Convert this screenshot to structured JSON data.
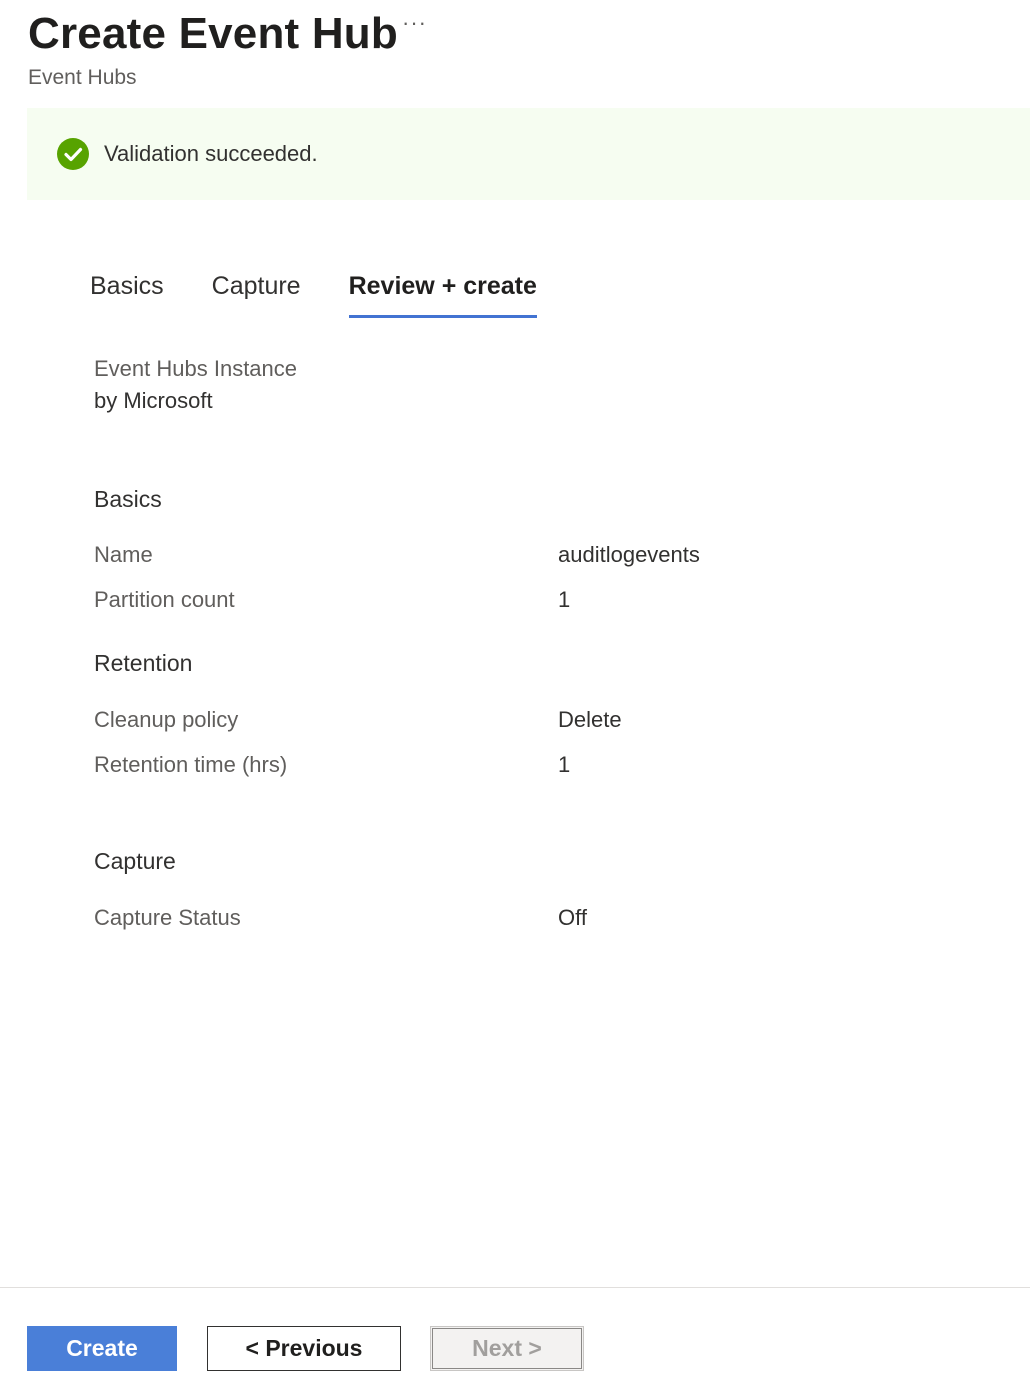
{
  "header": {
    "title": "Create Event Hub",
    "more_label": "···",
    "subtitle": "Event Hubs"
  },
  "banner": {
    "text": "Validation succeeded.",
    "icon": "success-check-icon",
    "color": "#57a300"
  },
  "tabs": [
    {
      "label": "Basics",
      "active": false
    },
    {
      "label": "Capture",
      "active": false
    },
    {
      "label": "Review + create",
      "active": true
    }
  ],
  "product": {
    "name": "Event Hubs Instance",
    "publisher": "by Microsoft"
  },
  "sections": {
    "basics": {
      "title": "Basics",
      "rows": [
        {
          "label": "Name",
          "value": "auditlogevents"
        },
        {
          "label": "Partition count",
          "value": "1"
        }
      ]
    },
    "retention": {
      "title": "Retention",
      "rows": [
        {
          "label": "Cleanup policy",
          "value": "Delete"
        },
        {
          "label": "Retention time (hrs)",
          "value": "1"
        }
      ]
    },
    "capture": {
      "title": "Capture",
      "rows": [
        {
          "label": "Capture Status",
          "value": "Off"
        }
      ]
    }
  },
  "footer": {
    "create_label": "Create",
    "previous_label": "< Previous",
    "next_label": "Next >",
    "accent": "#4a7fd8"
  }
}
